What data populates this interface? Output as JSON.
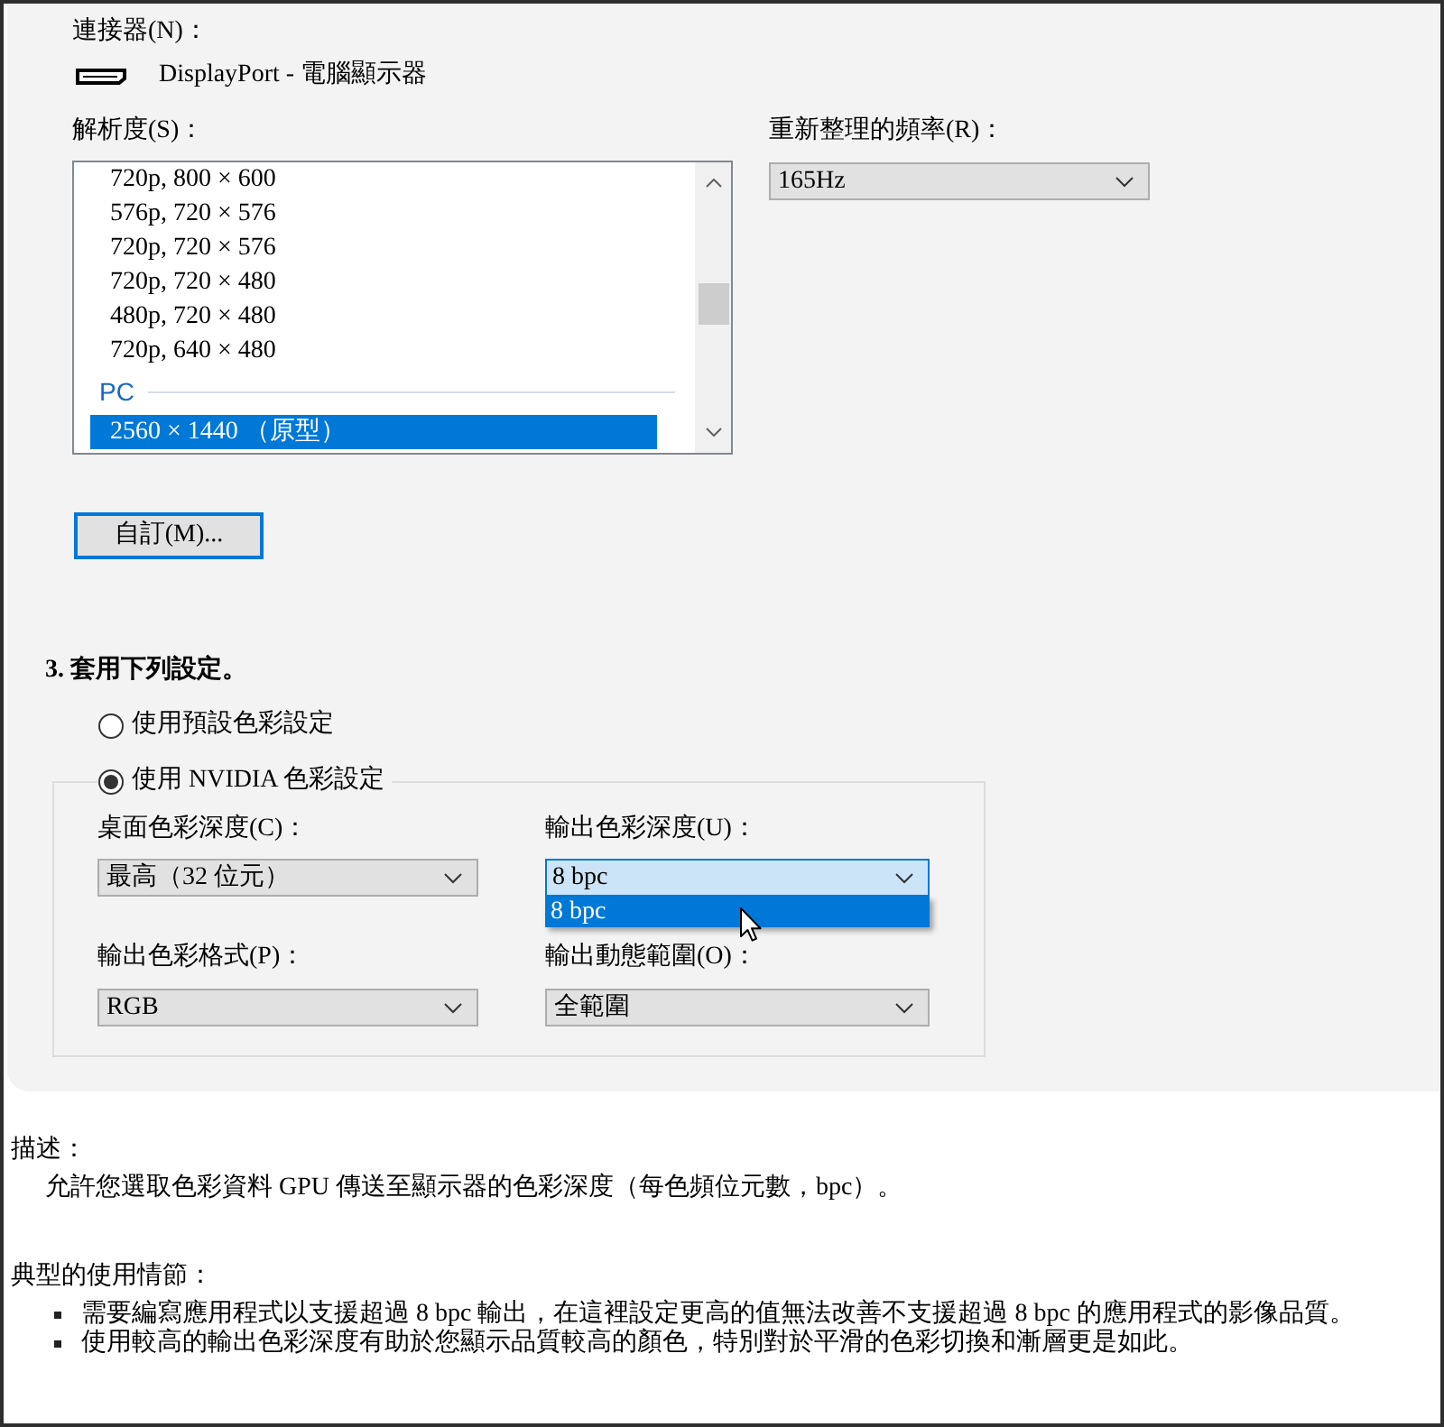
{
  "connector": {
    "label": "連接器(N)：",
    "value": "DisplayPort - 電腦顯示器"
  },
  "resolution": {
    "label": "解析度(S)：",
    "items": [
      {
        "kind": "item",
        "text": "720p, 800 × 600",
        "selected": false
      },
      {
        "kind": "item",
        "text": "576p, 720 × 576",
        "selected": false
      },
      {
        "kind": "item",
        "text": "720p, 720 × 576",
        "selected": false
      },
      {
        "kind": "item",
        "text": "720p, 720 × 480",
        "selected": false
      },
      {
        "kind": "item",
        "text": "480p, 720 × 480",
        "selected": false
      },
      {
        "kind": "item",
        "text": "720p, 640 × 480",
        "selected": false
      },
      {
        "kind": "group",
        "text": "PC"
      },
      {
        "kind": "item",
        "text": "2560 × 1440 （原型）",
        "selected": true
      }
    ]
  },
  "refresh_rate": {
    "label": "重新整理的頻率(R)：",
    "value": "165Hz"
  },
  "custom_button": {
    "label": "自訂(M)...",
    "default": true
  },
  "apply_settings": {
    "heading": "3. 套用下列設定。",
    "options": [
      {
        "label": "使用預設色彩設定",
        "selected": false
      },
      {
        "label": "使用 NVIDIA 色彩設定",
        "selected": true
      }
    ],
    "fields": [
      {
        "label": "桌面色彩深度(C)：",
        "value": "最高（32 位元）",
        "focused": false
      },
      {
        "label": "輸出色彩深度(U)：",
        "value": "8 bpc",
        "focused": true,
        "open_list": [
          {
            "text": "8 bpc",
            "selected": true
          }
        ]
      },
      {
        "label": "輸出色彩格式(P)：",
        "value": "RGB",
        "focused": false
      },
      {
        "label": "輸出動態範圍(O)：",
        "value": "全範圍",
        "focused": false
      }
    ]
  },
  "description": {
    "heading": "描述：",
    "text": "允許您選取色彩資料 GPU 傳送至顯示器的色彩深度（每色頻位元數，bpc）。"
  },
  "usage": {
    "heading": "典型的使用情節：",
    "bullets": [
      "需要編寫應用程式以支援超過 8 bpc 輸出，在這裡設定更高的值無法改善不支援超過 8 bpc 的應用程式的影像品質。",
      "使用較高的輸出色彩深度有助於您顯示品質較高的顏色，特別對於平滑的色彩切換和漸層更是如此。"
    ]
  }
}
